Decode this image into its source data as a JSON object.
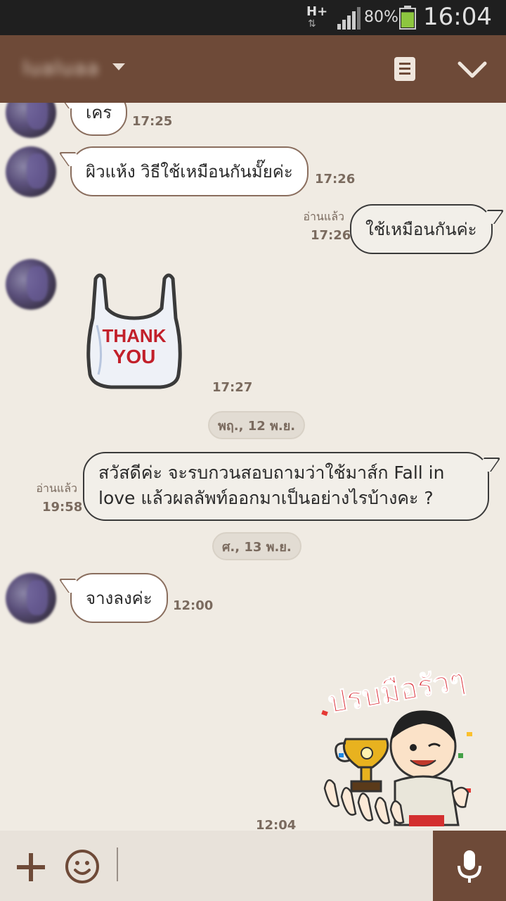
{
  "status_bar": {
    "network": "H+",
    "battery_percent": "80%",
    "battery_level": 0.8,
    "time": "16:04"
  },
  "header": {
    "chat_name": "lualuaa",
    "icons": [
      "chevron-down-icon",
      "notes-icon",
      "collapse-icon"
    ]
  },
  "messages": {
    "m1": {
      "text": "เคร",
      "time": "17:25"
    },
    "m2": {
      "text": "ผิวแห้ง วิธีใช้เหมือนกันมั๊ยค่ะ",
      "time": "17:26"
    },
    "m3": {
      "text": "ใช้เหมือนกันค่ะ",
      "read": "อ่านแล้ว",
      "time": "17:26"
    },
    "m4": {
      "sticker_text": "THANK YOU",
      "time": "17:27"
    },
    "date1": "พฤ., 12 พ.ย.",
    "m5": {
      "line1": "สวัสดีค่ะ จะรบกวนสอบถามว่าใช้มาส์ก Fall in",
      "line2": "love แล้วผลลัพท์ออกมาเป็นอย่างไรบ้างคะ ?",
      "read": "อ่านแล้ว",
      "time": "19:58"
    },
    "date2": "ศ., 13 พ.ย.",
    "m6": {
      "text": "จางลงค่ะ",
      "time": "12:00"
    },
    "m7": {
      "sticker_text": "ปรบมือรัวๆ",
      "time": "12:04"
    }
  },
  "colors": {
    "header": "#6e4a38",
    "background": "#f0ebe3",
    "bubble_border": "#8a6e5e"
  }
}
